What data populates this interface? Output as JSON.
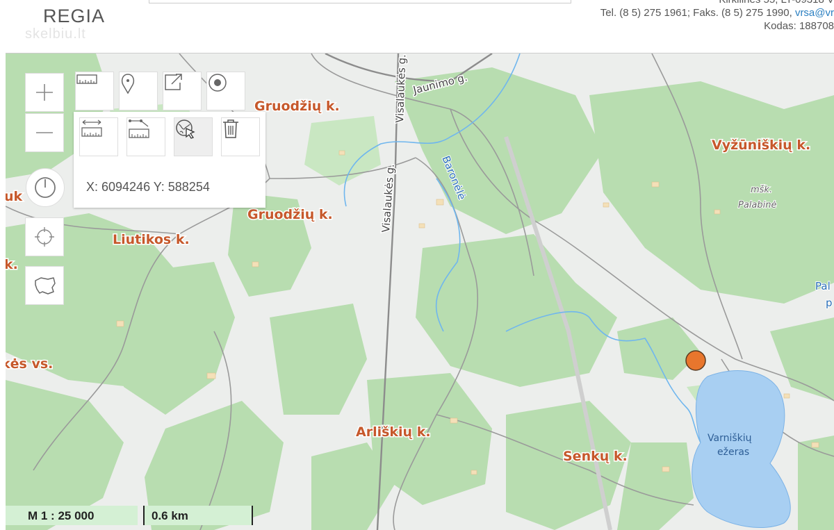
{
  "header": {
    "logo": "REGIA",
    "watermark": "skelbiu.lt",
    "contact_line0": "Kirkilinės 55, LT-09318 V",
    "contact_line1_prefix": "Tel. (8 5) 275 1961; Faks. (8 5) 275 1990, ",
    "contact_email": "vrsa@vr",
    "contact_line2": "Kodas: 188708"
  },
  "map": {
    "labels": {
      "gruodziu1": "Gruodžių k.",
      "gruodziu2": "Gruodžių k.",
      "vyzuniskiu": "Vyžūniškių k.",
      "liutikos": "Liutikos k.",
      "arliskiu": "Arliškių k.",
      "senku": "Senkų k.",
      "kes_vs": "kės vs.",
      "uk": "uk",
      "k_left": "k.",
      "msk": "mšk.",
      "palabine": "Palabinė",
      "pal": "Pal",
      "p": "p",
      "jaunimo": "Jaunimo g.",
      "visalaukes1": "Visalaukės g.",
      "visalaukes2": "Visalaukės g.",
      "baronele": "Baronėlė",
      "lake1": "Varniškių",
      "lake2": "ežeras"
    },
    "marker_color": "#e8762d",
    "lake_color": "#a8cff2",
    "forest_color": "#b8ddb0"
  },
  "controls": {
    "zoom_in_icon": "plus-icon",
    "zoom_out_icon": "minus-icon",
    "power_icon": "power-icon",
    "locate_icon": "crosshair-icon",
    "country_icon": "lithuania-outline-icon"
  },
  "tools_panel": {
    "coords": "X: 6094246 Y: 588254",
    "row1": [
      "ruler-icon",
      "pin-icon",
      "share-icon",
      "target-icon"
    ],
    "row2": [
      "measure-distance-icon",
      "measure-area-icon",
      "globe-cursor-icon",
      "trash-icon"
    ]
  },
  "scale": {
    "ratio": "M 1 : 25 000",
    "length": "0.6 km"
  }
}
